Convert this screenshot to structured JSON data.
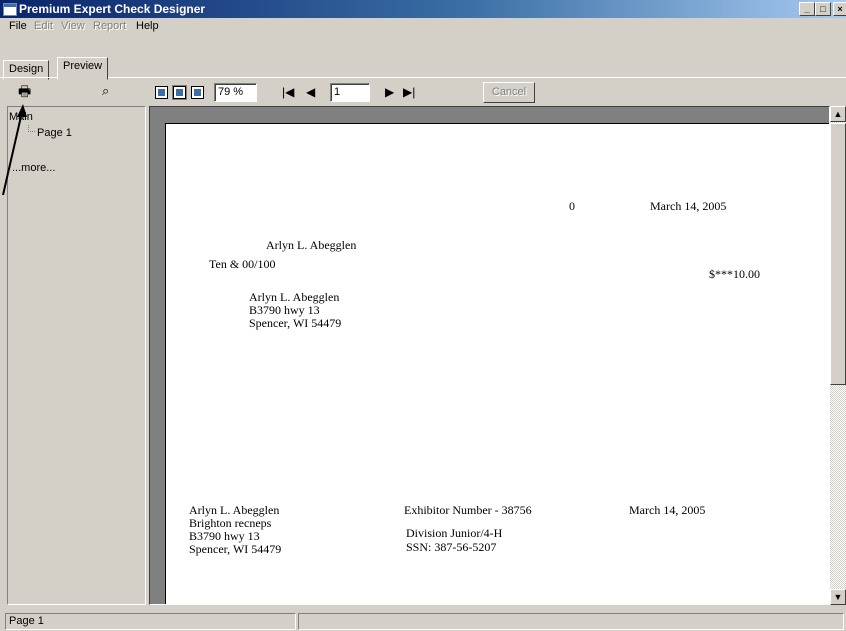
{
  "window": {
    "title": "Premium Expert Check Designer",
    "controls": [
      "_",
      "□",
      "×"
    ]
  },
  "menu": [
    "File",
    "Edit",
    "View",
    "Report",
    "Help"
  ],
  "tabs": [
    "Design",
    "Preview"
  ],
  "toolbar": {
    "zoom": "79 %",
    "page_number": "1",
    "cancel_label": "Cancel"
  },
  "tree": {
    "root": "Main",
    "child": "Page 1",
    "more": "...more..."
  },
  "check": {
    "number": "0",
    "date": "March 14, 2005",
    "payee": "Arlyn L. Abegglen",
    "amount_words": "Ten & 00/100",
    "amount": "$***10.00",
    "address": [
      "Arlyn L. Abegglen",
      "B3790 hwy 13",
      "Spencer, WI  54479"
    ]
  },
  "stub": {
    "left": [
      "Arlyn L. Abegglen",
      "Brighton recneps",
      "B3790 hwy 13",
      "Spencer, WI  54479"
    ],
    "exhibitor": "Exhibitor Number -  38756",
    "division": "Division  Junior/4-H",
    "ssn": "SSN:   387-56-5207",
    "date": "March 14, 2005"
  },
  "status": {
    "page": "Page 1"
  }
}
